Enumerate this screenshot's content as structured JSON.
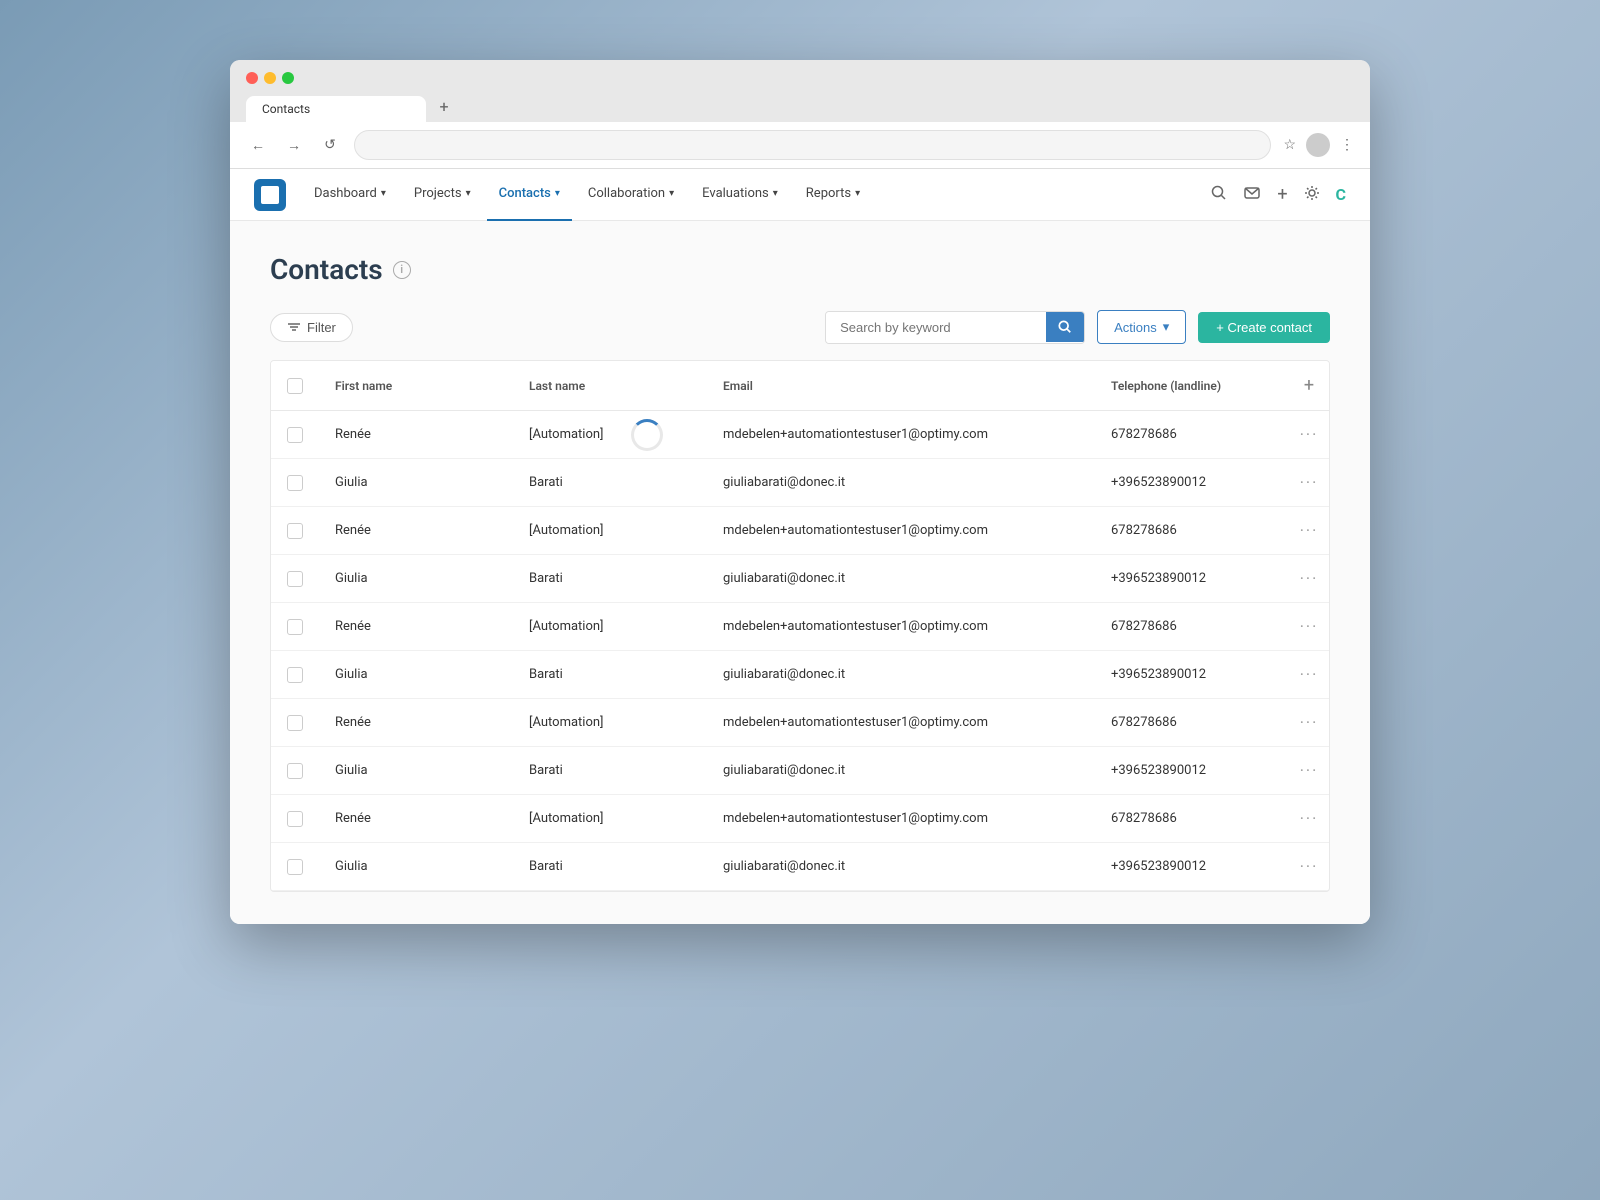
{
  "browser": {
    "tab_title": "Contacts",
    "tab_plus": "+",
    "nav_back": "←",
    "nav_forward": "→",
    "nav_refresh": "↺",
    "address_url": "",
    "icons": {
      "star": "☆",
      "menu": "⋮"
    }
  },
  "nav": {
    "logo_label": "O",
    "items": [
      {
        "id": "dashboard",
        "label": "Dashboard",
        "has_dropdown": true,
        "active": false
      },
      {
        "id": "projects",
        "label": "Projects",
        "has_dropdown": true,
        "active": false
      },
      {
        "id": "contacts",
        "label": "Contacts",
        "has_dropdown": true,
        "active": true
      },
      {
        "id": "collaboration",
        "label": "Collaboration",
        "has_dropdown": true,
        "active": false
      },
      {
        "id": "evaluations",
        "label": "Evaluations",
        "has_dropdown": true,
        "active": false
      },
      {
        "id": "reports",
        "label": "Reports",
        "has_dropdown": true,
        "active": false
      }
    ]
  },
  "page": {
    "title": "Contacts",
    "info_icon": "i"
  },
  "toolbar": {
    "filter_label": "Filter",
    "search_placeholder": "Search by keyword",
    "actions_label": "Actions",
    "actions_chevron": "▾",
    "create_label": "+ Create contact"
  },
  "table": {
    "columns": [
      {
        "id": "checkbox",
        "label": ""
      },
      {
        "id": "first_name",
        "label": "First name"
      },
      {
        "id": "last_name",
        "label": "Last name"
      },
      {
        "id": "email",
        "label": "Email"
      },
      {
        "id": "telephone",
        "label": "Telephone (landline)"
      },
      {
        "id": "actions",
        "label": "+"
      }
    ],
    "rows": [
      {
        "first_name": "Renée",
        "last_name": "[Automation]",
        "email": "mdebelen+automationtestuser1@optimy.com",
        "telephone": "678278686",
        "loading": true
      },
      {
        "first_name": "Giulia",
        "last_name": "Barati",
        "email": "giuliabarati@donec.it",
        "telephone": "+396523890012",
        "loading": false
      },
      {
        "first_name": "Renée",
        "last_name": "[Automation]",
        "email": "mdebelen+automationtestuser1@optimy.com",
        "telephone": "678278686",
        "loading": false
      },
      {
        "first_name": "Giulia",
        "last_name": "Barati",
        "email": "giuliabarati@donec.it",
        "telephone": "+396523890012",
        "loading": false
      },
      {
        "first_name": "Renée",
        "last_name": "[Automation]",
        "email": "mdebelen+automationtestuser1@optimy.com",
        "telephone": "678278686",
        "loading": false
      },
      {
        "first_name": "Giulia",
        "last_name": "Barati",
        "email": "giuliabarati@donec.it",
        "telephone": "+396523890012",
        "loading": false
      },
      {
        "first_name": "Renée",
        "last_name": "[Automation]",
        "email": "mdebelen+automationtestuser1@optimy.com",
        "telephone": "678278686",
        "loading": false
      },
      {
        "first_name": "Giulia",
        "last_name": "Barati",
        "email": "giuliabarati@donec.it",
        "telephone": "+396523890012",
        "loading": false
      },
      {
        "first_name": "Renée",
        "last_name": "[Automation]",
        "email": "mdebelen+automationtestuser1@optimy.com",
        "telephone": "678278686",
        "loading": false
      },
      {
        "first_name": "Giulia",
        "last_name": "Barati",
        "email": "giuliabarati@donec.it",
        "telephone": "+396523890012",
        "loading": false
      }
    ]
  },
  "colors": {
    "accent_blue": "#1a6faf",
    "accent_teal": "#2bb5a0",
    "search_blue": "#3a7fc1"
  }
}
